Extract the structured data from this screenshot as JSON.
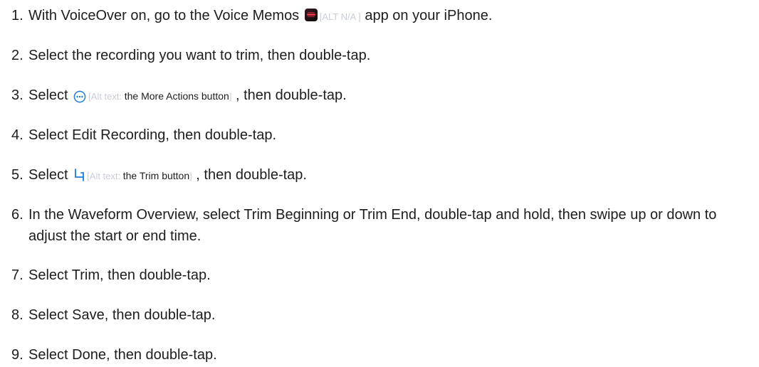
{
  "steps": [
    {
      "number": "1.",
      "before": "With VoiceOver on, go to the Voice Memos ",
      "icon": "voice-memos-app-icon",
      "alt_label": "[ALT N/A ]",
      "after": " app on your iPhone."
    },
    {
      "number": "2.",
      "text": "Select the recording you want to trim, then double-tap."
    },
    {
      "number": "3.",
      "before": "Select ",
      "icon": "more-actions-icon",
      "alt_prefix": "[Alt text: ",
      "alt_desc": "the More Actions button",
      "alt_suffix": "]",
      "after": " , then double-tap."
    },
    {
      "number": "4.",
      "text": "Select Edit Recording, then double-tap."
    },
    {
      "number": "5.",
      "before": "Select ",
      "icon": "trim-icon",
      "alt_prefix": "[Alt text: ",
      "alt_desc": "the Trim button",
      "alt_suffix": "]",
      "after": " , then double-tap."
    },
    {
      "number": "6.",
      "text": "In the Waveform Overview, select Trim Beginning or Trim End, double-tap and hold, then swipe up or down to adjust the start or end time."
    },
    {
      "number": "7.",
      "text": "Select Trim, then double-tap."
    },
    {
      "number": "8.",
      "text": "Select Save, then double-tap."
    },
    {
      "number": "9.",
      "text": "Select Done, then double-tap."
    }
  ],
  "colors": {
    "text": "#1d1d1f",
    "alt_text": "#c9ced6",
    "icon_blue": "#1a7ce8",
    "memo_red": "#e2324a"
  }
}
